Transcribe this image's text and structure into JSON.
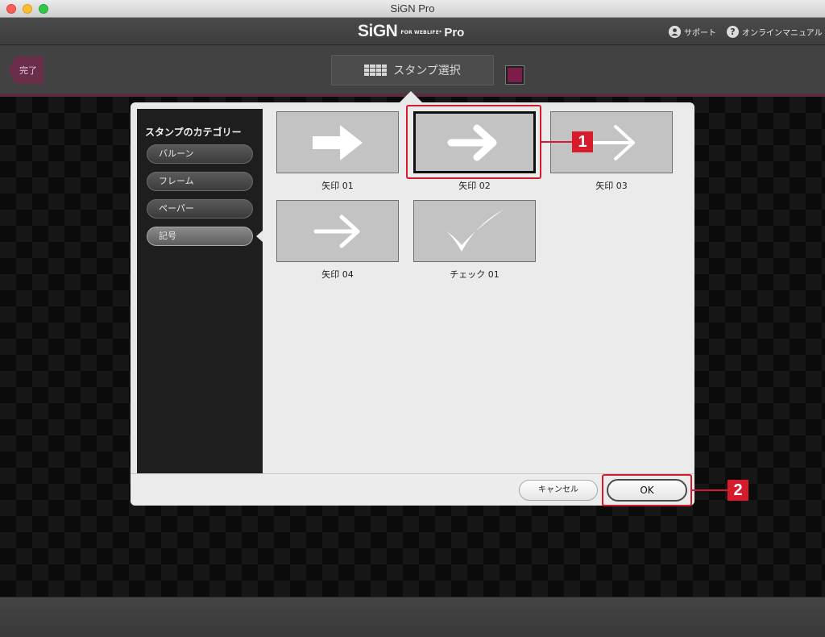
{
  "window": {
    "title": "SiGN Pro"
  },
  "header": {
    "logo_main": "SiGN",
    "logo_sub": "FOR WEBLIFE*",
    "logo_pro": "Pro",
    "support_label": "サポート",
    "manual_label": "オンラインマニュアル"
  },
  "toolbar": {
    "done_label": "完了",
    "stamp_select_label": "スタンプ選択",
    "swatch_color": "#7a1d48",
    "accent_color": "#5b2a43"
  },
  "dialog": {
    "category_title": "スタンプのカテゴリー",
    "categories": [
      {
        "label": "バルーン",
        "selected": false
      },
      {
        "label": "フレーム",
        "selected": false
      },
      {
        "label": "ペーパー",
        "selected": false
      },
      {
        "label": "記号",
        "selected": true
      }
    ],
    "stamps": [
      {
        "label": "矢印 01",
        "icon": "bold-arrow-right-icon",
        "selected": false
      },
      {
        "label": "矢印 02",
        "icon": "chevron-arrow-right-icon",
        "selected": true
      },
      {
        "label": "矢印 03",
        "icon": "thin-arrow-right-icon",
        "selected": false
      },
      {
        "label": "矢印 04",
        "icon": "thin-arrow-right-icon",
        "selected": false
      },
      {
        "label": "チェック 01",
        "icon": "checkmark-icon",
        "selected": false
      }
    ],
    "cancel_label": "キャンセル",
    "ok_label": "OK"
  },
  "callouts": [
    {
      "number": "1",
      "color": "#d71a2c"
    },
    {
      "number": "2",
      "color": "#d71a2c"
    }
  ]
}
